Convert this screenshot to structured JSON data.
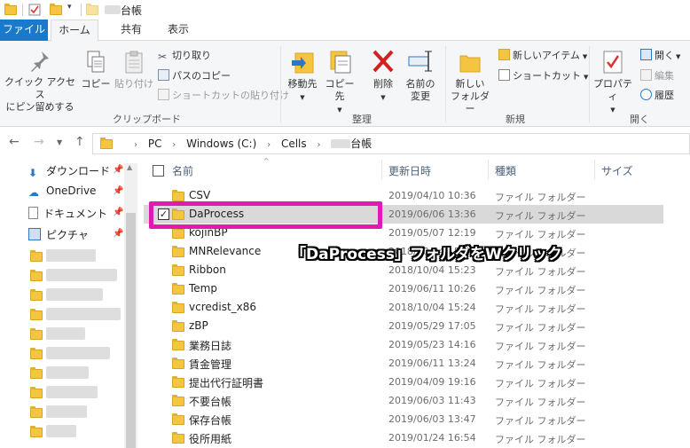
{
  "window": {
    "title_suffix": "台帳"
  },
  "tabs": [
    "ファイル",
    "ホーム",
    "共有",
    "表示"
  ],
  "ribbon": {
    "clipboard": {
      "pin_label_1": "クイック アクセス",
      "pin_label_2": "にピン留めする",
      "copy": "コピー",
      "paste": "貼り付け",
      "cut": "切り取り",
      "copy_path": "パスのコピー",
      "paste_shortcut": "ショートカットの貼り付け",
      "group": "クリップボード"
    },
    "organize": {
      "move_to": "移動先",
      "copy_to": "コピー先",
      "delete": "削除",
      "rename_1": "名前の",
      "rename_2": "変更",
      "group": "整理"
    },
    "new": {
      "new_folder_1": "新しい",
      "new_folder_2": "フォルダー",
      "new_item": "新しいアイテム",
      "shortcut": "ショートカット",
      "group": "新規"
    },
    "open": {
      "properties": "プロパティ",
      "open": "開く",
      "edit": "編集",
      "history": "履歴",
      "group": "開く"
    }
  },
  "address": {
    "parts": [
      "PC",
      "Windows (C:)",
      "Cells"
    ],
    "last_suffix": "台帳"
  },
  "nav_pane": {
    "items": [
      {
        "label": "ダウンロード",
        "icon": "download-icon"
      },
      {
        "label": "OneDrive",
        "icon": "cloud-icon"
      },
      {
        "label": "ドキュメント",
        "icon": "document-icon"
      },
      {
        "label": "ピクチャ",
        "icon": "picture-icon"
      }
    ]
  },
  "columns": {
    "name": "名前",
    "modified": "更新日時",
    "type": "種類",
    "size": "サイズ"
  },
  "files": [
    {
      "name": "CSV",
      "modified": "2019/04/10 10:36",
      "type": "ファイル フォルダー"
    },
    {
      "name": "DaProcess",
      "modified": "2019/06/06 13:36",
      "type": "ファイル フォルダー",
      "selected": true
    },
    {
      "name": "kojinBP",
      "modified": "2019/05/07 12:19",
      "type": "ファイル フォルダー"
    },
    {
      "name": "MNRelevance",
      "modified": "2018/10/04 15:22",
      "type": "ファイル フォルダー"
    },
    {
      "name": "Ribbon",
      "modified": "2018/10/04 15:23",
      "type": "ファイル フォルダー"
    },
    {
      "name": "Temp",
      "modified": "2019/06/11 10:26",
      "type": "ファイル フォルダー"
    },
    {
      "name": "vcredist_x86",
      "modified": "2018/10/04 15:24",
      "type": "ファイル フォルダー"
    },
    {
      "name": "zBP",
      "modified": "2019/05/29 17:05",
      "type": "ファイル フォルダー"
    },
    {
      "name": "業務日誌",
      "modified": "2019/05/23 14:16",
      "type": "ファイル フォルダー"
    },
    {
      "name": "賃金管理",
      "modified": "2019/06/11 13:24",
      "type": "ファイル フォルダー"
    },
    {
      "name": "提出代行証明書",
      "modified": "2019/04/09 19:16",
      "type": "ファイル フォルダー"
    },
    {
      "name": "不要台帳",
      "modified": "2019/06/03 11:43",
      "type": "ファイル フォルダー"
    },
    {
      "name": "保存台帳",
      "modified": "2019/06/03 13:47",
      "type": "ファイル フォルダー"
    },
    {
      "name": "役所用紙",
      "modified": "2019/01/24 16:54",
      "type": "ファイル フォルダー"
    }
  ],
  "annotation": "「DaProcess」フォルダをWクリック",
  "colors": {
    "accent": "#1979ca",
    "highlight": "#e01ab5"
  }
}
